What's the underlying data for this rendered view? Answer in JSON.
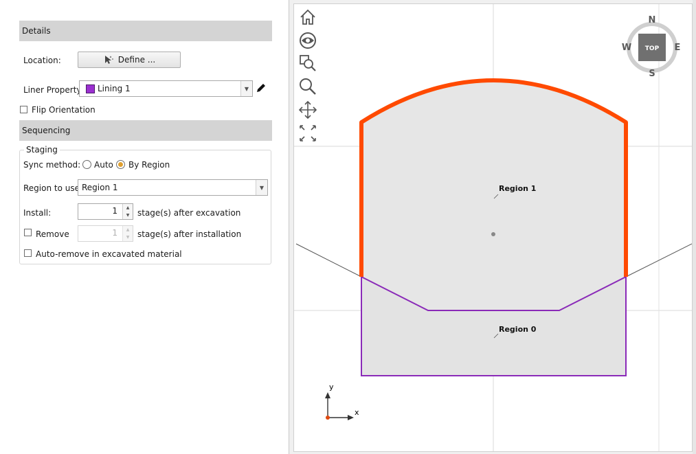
{
  "details": {
    "header": "Details",
    "location_label": "Location:",
    "define_button": "Define ...",
    "liner_property_label": "Liner Property:",
    "liner_property_value": "Lining 1",
    "liner_color": "#9b30d0",
    "flip_orientation_label": "Flip Orientation",
    "flip_orientation_checked": false
  },
  "sequencing": {
    "header": "Sequencing",
    "staging_title": "Staging",
    "sync_method_label": "Sync method:",
    "sync_options": [
      "Auto",
      "By Region"
    ],
    "sync_selected": "By Region",
    "region_to_use_label": "Region to use:",
    "region_to_use_value": "Region 1",
    "install_label": "Install:",
    "install_value": "1",
    "install_suffix": "stage(s) after excavation",
    "remove_label": "Remove",
    "remove_checked": false,
    "remove_value": "1",
    "remove_suffix": "stage(s) after installation",
    "auto_remove_label": "Auto-remove in excavated material",
    "auto_remove_checked": false
  },
  "viewport": {
    "tools": [
      "home-icon",
      "eye-icon",
      "zoom-window-icon",
      "zoom-icon",
      "pan-icon",
      "extents-icon"
    ],
    "compass": {
      "n": "N",
      "s": "S",
      "e": "E",
      "w": "W",
      "center": "TOP"
    },
    "regions": [
      {
        "name": "Region 1"
      },
      {
        "name": "Region 0"
      }
    ],
    "axes": {
      "x": "x",
      "y": "y"
    },
    "colors": {
      "lining": "#ff4a00",
      "region0_outline": "#8a2ab8",
      "region_fill": "#e3e3e3"
    }
  }
}
